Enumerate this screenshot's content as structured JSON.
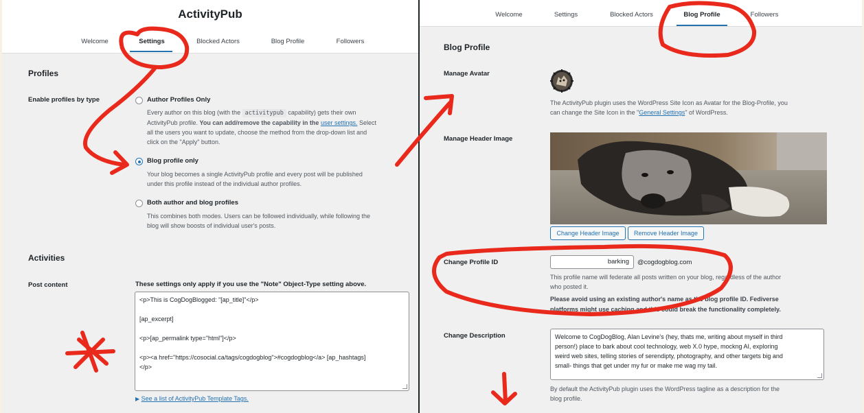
{
  "left": {
    "app_title": "ActivityPub",
    "tabs": [
      "Welcome",
      "Settings",
      "Blocked Actors",
      "Blog Profile",
      "Followers"
    ],
    "active_tab": "Settings",
    "profiles": {
      "heading": "Profiles",
      "label": "Enable profiles by type",
      "options": [
        {
          "label": "Author Profiles Only",
          "checked": false,
          "desc_1": "Every author on this blog (with the",
          "desc_code": "activitypub",
          "desc_2": "capability) gets their own",
          "desc_3": "ActivityPub profile.",
          "desc_bold": "You can add/remove the capability in the",
          "desc_link": "user settings.",
          "desc_4": "Select",
          "desc_5": "all the users you want to update, choose the method from the drop-down list and",
          "desc_6": "click on the \"Apply\" button."
        },
        {
          "label": "Blog profile only",
          "checked": true,
          "desc_1": "Your blog becomes a single ActivityPub profile and every post will be published",
          "desc_2": "under this profile instead of the individual author profiles."
        },
        {
          "label": "Both author and blog profiles",
          "checked": false,
          "desc_1": "This combines both modes. Users can be followed individually, while following the",
          "desc_2": "blog will show boosts of individual user's posts."
        }
      ]
    },
    "activities": {
      "heading": "Activities",
      "label": "Post content",
      "note": "These settings only apply if you use the \"Note\" Object-Type setting above.",
      "template_lines": [
        "<p>This is CogDogBlogged: \"[ap_title]\"</p>",
        "[ap_excerpt]",
        "<p>[ap_permalink type=\"html\"]</p>",
        "<p><a href=\"https://cosocial.ca/tags/cogdogblog\">#cogdogblog</a>  [ap_hashtags]",
        "</p>"
      ],
      "tags_link": "See a list of ActivityPub Template Tags."
    }
  },
  "right": {
    "tabs": [
      "Welcome",
      "Settings",
      "Blocked Actors",
      "Blog Profile",
      "Followers"
    ],
    "active_tab": "Blog Profile",
    "heading": "Blog Profile",
    "avatar": {
      "label": "Manage Avatar",
      "desc_1": "The ActivityPub plugin uses the WordPress Site Icon as Avatar for the Blog-Profile, you",
      "desc_2": "can change the Site Icon in the \"",
      "desc_link": "General Settings",
      "desc_3": "\" of WordPress."
    },
    "header_image": {
      "label": "Manage Header Image",
      "change_button": "Change Header Image",
      "remove_button": "Remove Header Image"
    },
    "profile_id": {
      "label": "Change Profile ID",
      "value": "barking",
      "domain": "@cogdogblog.com",
      "desc_1": "This profile name will federate all posts written on your blog, regardless of the author",
      "desc_2": "who posted it.",
      "warn_1": "Please avoid using an existing author's name as the blog profile ID. Fediverse",
      "warn_2": "platforms might use caching and this could break the functionality completely."
    },
    "description": {
      "label": "Change Description",
      "lines": [
        "Welcome to CogDogBlog, Alan Levine's (hey, thats me, writing about myself in third",
        "person!) place to bark about cool technology, web X.0 hype, mockng AI,  exploring",
        "weird web sites, telling stories of serendipty, photography, and other targets big and",
        "small- things that get under my fur or make me wag my tail."
      ],
      "help_1": "By default the ActivityPub plugin uses the WordPress tagline as a description for the",
      "help_2": "blog profile."
    }
  },
  "colors": {
    "accent": "#2271b1",
    "annotation": "#e8291c",
    "background": "#f0f0f1"
  }
}
